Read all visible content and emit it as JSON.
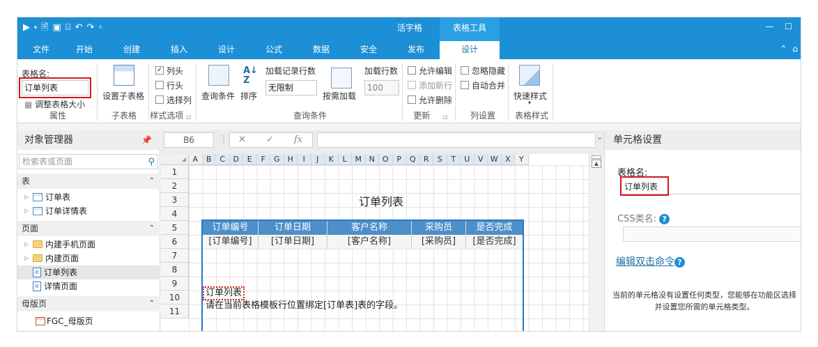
{
  "app": {
    "title": "活字格",
    "context_group": "表格工具",
    "window_buttons": [
      "—",
      "☐"
    ],
    "qat_icons": [
      "run-icon",
      "save-icon",
      "save-as-icon",
      "open-icon",
      "undo-icon",
      "redo-icon",
      "customize-icon"
    ]
  },
  "ribbon_tabs": [
    "文件",
    "开始",
    "创建",
    "插入",
    "设计",
    "公式",
    "数据",
    "安全",
    "发布",
    "设计"
  ],
  "ribbon_tabs_active_index": 9,
  "ribbon": {
    "properties": {
      "table_name_label": "表格名:",
      "table_name_value": "订单列表",
      "adjust_size": "调整表格大小",
      "group": "属性"
    },
    "subtable": {
      "button": "设置子表格",
      "group": "子表格"
    },
    "style_options": {
      "items": [
        {
          "label": "列头",
          "checked": true
        },
        {
          "label": "行头",
          "checked": false
        },
        {
          "label": "选择列",
          "checked": false
        }
      ],
      "group": "样式选项"
    },
    "query": {
      "query_condition": "查询条件",
      "sort": "排序",
      "load_records_label": "加载记录行数",
      "load_records_value": "无限制",
      "load_on_demand": "按需加载",
      "load_rows_label": "加载行数",
      "load_rows_value": "100",
      "group": "查询条件"
    },
    "update": {
      "items": [
        {
          "label": "允许编辑",
          "checked": false,
          "disabled": false
        },
        {
          "label": "添加新行",
          "checked": false,
          "disabled": true
        },
        {
          "label": "允许删除",
          "checked": false,
          "disabled": false
        }
      ],
      "group": "更新"
    },
    "columns": {
      "items": [
        {
          "label": "忽略隐藏",
          "checked": false
        },
        {
          "label": "自动合并",
          "checked": false
        }
      ],
      "group": "列设置"
    },
    "table_style": {
      "button": "快速样式",
      "group": "表格样式"
    }
  },
  "object_manager": {
    "title": "对象管理器",
    "search_placeholder": "检索表或页面",
    "sections": {
      "tables": {
        "label": "表",
        "items": [
          "订单表",
          "订单详情表"
        ]
      },
      "pages": {
        "label": "页面",
        "items": [
          "内建手机页面",
          "内建页面",
          "订单列表",
          "详情页面"
        ],
        "selected": "订单列表"
      },
      "masters": {
        "label": "母版页",
        "items": [
          "FGC_母版页"
        ]
      }
    }
  },
  "formula_bar": {
    "cell_ref": "B6",
    "cancel": "✕",
    "confirm": "✓",
    "fx": "fx"
  },
  "grid": {
    "columns": [
      "A",
      "B",
      "C",
      "D",
      "E",
      "F",
      "G",
      "H",
      "I",
      "J",
      "K",
      "L",
      "M",
      "N",
      "O",
      "P",
      "Q",
      "R",
      "S",
      "T",
      "U",
      "V",
      "W",
      "X",
      "Y"
    ],
    "rows": [
      "1",
      "2",
      "3",
      "4",
      "5",
      "6",
      "7",
      "8",
      "9",
      "10",
      "11"
    ],
    "title": "订单列表",
    "headers": [
      "订单编号",
      "订单日期",
      "客户名称",
      "采购员",
      "是否完成"
    ],
    "bindings": [
      "[订单编号]",
      "[订单日期]",
      "[客户名称]",
      "[采购员]",
      "[是否完成]"
    ],
    "placeholder_title": "订单列表",
    "placeholder_hint": "请在当前表格模板行位置绑定[订单表]表的字段。"
  },
  "cell_settings": {
    "title": "单元格设置",
    "table_name_label": "表格名:",
    "table_name_value": "订单列表",
    "css_label": "CSS类名:",
    "edit_dblclick": "编辑双击命令",
    "hint": "当前的单元格没有设置任何类型，您能够在功能区选择并设置您所需的单元格类型。"
  },
  "colors": {
    "brand_blue": "#1d8fd6",
    "table_header_blue": "#4d8fc8",
    "highlight_red": "#d0171e"
  }
}
